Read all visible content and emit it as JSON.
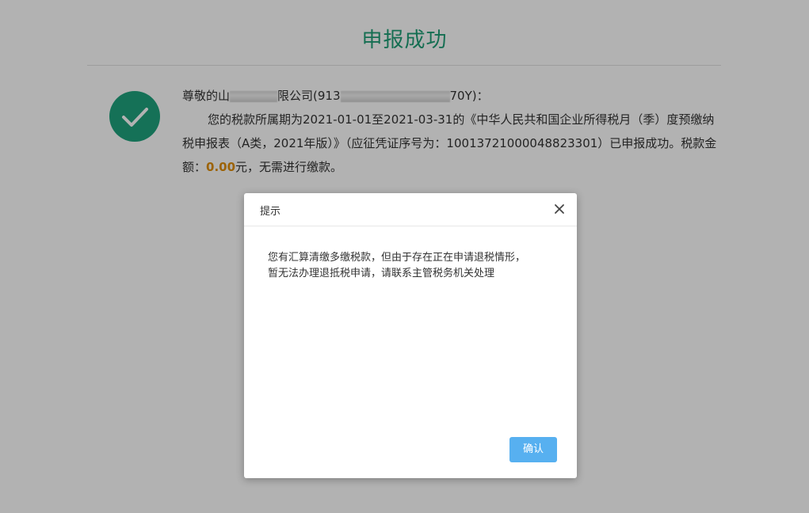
{
  "page": {
    "title": "申报成功"
  },
  "message": {
    "greeting_prefix": "尊敬的山",
    "greeting_mid": "限公司(913",
    "greeting_suffix": "70Y)：",
    "line1": "您的税款所属期为2021-01-01至2021-03-31的《中华人民共和国企业所得税月（季）度预缴纳税申报表（A类，2021年版）》（应征凭证序号为：10013721000048823301）已申报成功。税款金额：",
    "amount": "0.00",
    "line1_tail": "元，无需进行缴款。"
  },
  "dialog": {
    "title": "提示",
    "body_line1": "您有汇算清缴多缴税款，但由于存在正在申请退税情形，",
    "body_line2": "暂无法办理退抵税申请，请联系主管税务机关处理",
    "confirm_label": "确认"
  },
  "colors": {
    "accent_green": "#1f9e76",
    "amount_orange": "#e08e0b",
    "button_blue": "#57b0f0"
  },
  "icons": {
    "success": "check-circle-icon",
    "close": "close-icon"
  }
}
